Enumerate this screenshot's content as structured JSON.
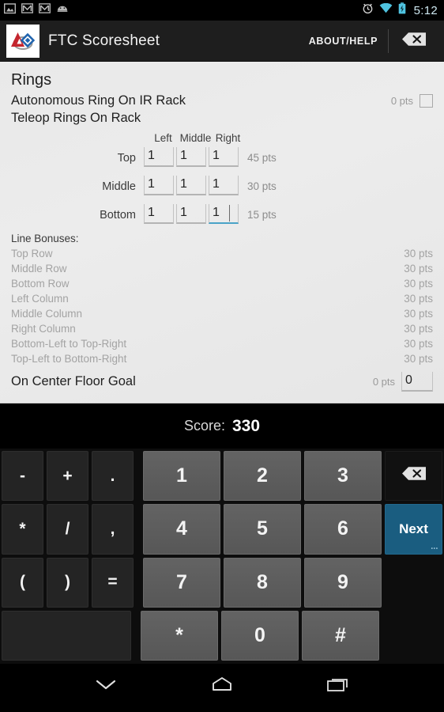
{
  "status_bar": {
    "time": "5:12",
    "left_icons": [
      "screenshot-icon",
      "gmail-icon",
      "gmail-icon",
      "android-icon"
    ],
    "right_icons": [
      "alarm-icon",
      "wifi-icon",
      "battery-charging-icon"
    ],
    "accent_color": "#5ec8e8"
  },
  "action_bar": {
    "app_title": "FTC Scoresheet",
    "about_help_label": "ABOUT/HELP",
    "logo_name": "ftc-logo",
    "back_icon": "backspace-icon"
  },
  "content": {
    "section_title": "Rings",
    "autonomous": {
      "label": "Autonomous Ring On IR Rack",
      "pts": "0 pts",
      "checked": false
    },
    "teleop_label": "Teleop Rings On Rack",
    "grid": {
      "column_headers": [
        "Left",
        "Middle",
        "Right"
      ],
      "rows": [
        {
          "label": "Top",
          "values": [
            "1",
            "1",
            "1"
          ],
          "pts": "45 pts",
          "focused_col": -1
        },
        {
          "label": "Middle",
          "values": [
            "1",
            "1",
            "1"
          ],
          "pts": "30 pts",
          "focused_col": -1
        },
        {
          "label": "Bottom",
          "values": [
            "1",
            "1",
            "1"
          ],
          "pts": "15 pts",
          "focused_col": 2
        }
      ]
    },
    "line_bonuses": {
      "title": "Line Bonuses:",
      "items": [
        {
          "name": "Top Row",
          "pts": "30 pts"
        },
        {
          "name": "Middle Row",
          "pts": "30 pts"
        },
        {
          "name": "Bottom Row",
          "pts": "30 pts"
        },
        {
          "name": "Left Column",
          "pts": "30 pts"
        },
        {
          "name": "Middle Column",
          "pts": "30 pts"
        },
        {
          "name": "Right Column",
          "pts": "30 pts"
        },
        {
          "name": "Bottom-Left to Top-Right",
          "pts": "30 pts"
        },
        {
          "name": "Top-Left to Bottom-Right",
          "pts": "30 pts"
        }
      ]
    },
    "floor_goal": {
      "label": "On Center Floor Goal",
      "pts": "0 pts",
      "value": "0"
    }
  },
  "score_bar": {
    "label": "Score:",
    "value": "330"
  },
  "keyboard": {
    "rows": [
      {
        "symbols": [
          "-",
          "+",
          "."
        ],
        "numbers": [
          "1",
          "2",
          "3"
        ],
        "action": {
          "type": "backspace",
          "label": "",
          "name": "backspace-key"
        }
      },
      {
        "symbols": [
          "*",
          "/",
          ","
        ],
        "numbers": [
          "4",
          "5",
          "6"
        ],
        "action": {
          "type": "next",
          "label": "Next",
          "name": "next-key"
        }
      },
      {
        "symbols": [
          "(",
          ")",
          "="
        ],
        "numbers": [
          "7",
          "8",
          "9"
        ],
        "action": {
          "type": "none",
          "label": "",
          "name": ""
        }
      },
      {
        "symbols": [
          "space"
        ],
        "numbers": [
          "*",
          "0",
          "#"
        ],
        "action": {
          "type": "none",
          "label": "",
          "name": ""
        }
      }
    ],
    "next_color": "#1a5d80"
  },
  "nav_bar": {
    "buttons": [
      "hide-keyboard-icon",
      "home-icon",
      "recents-icon"
    ]
  }
}
